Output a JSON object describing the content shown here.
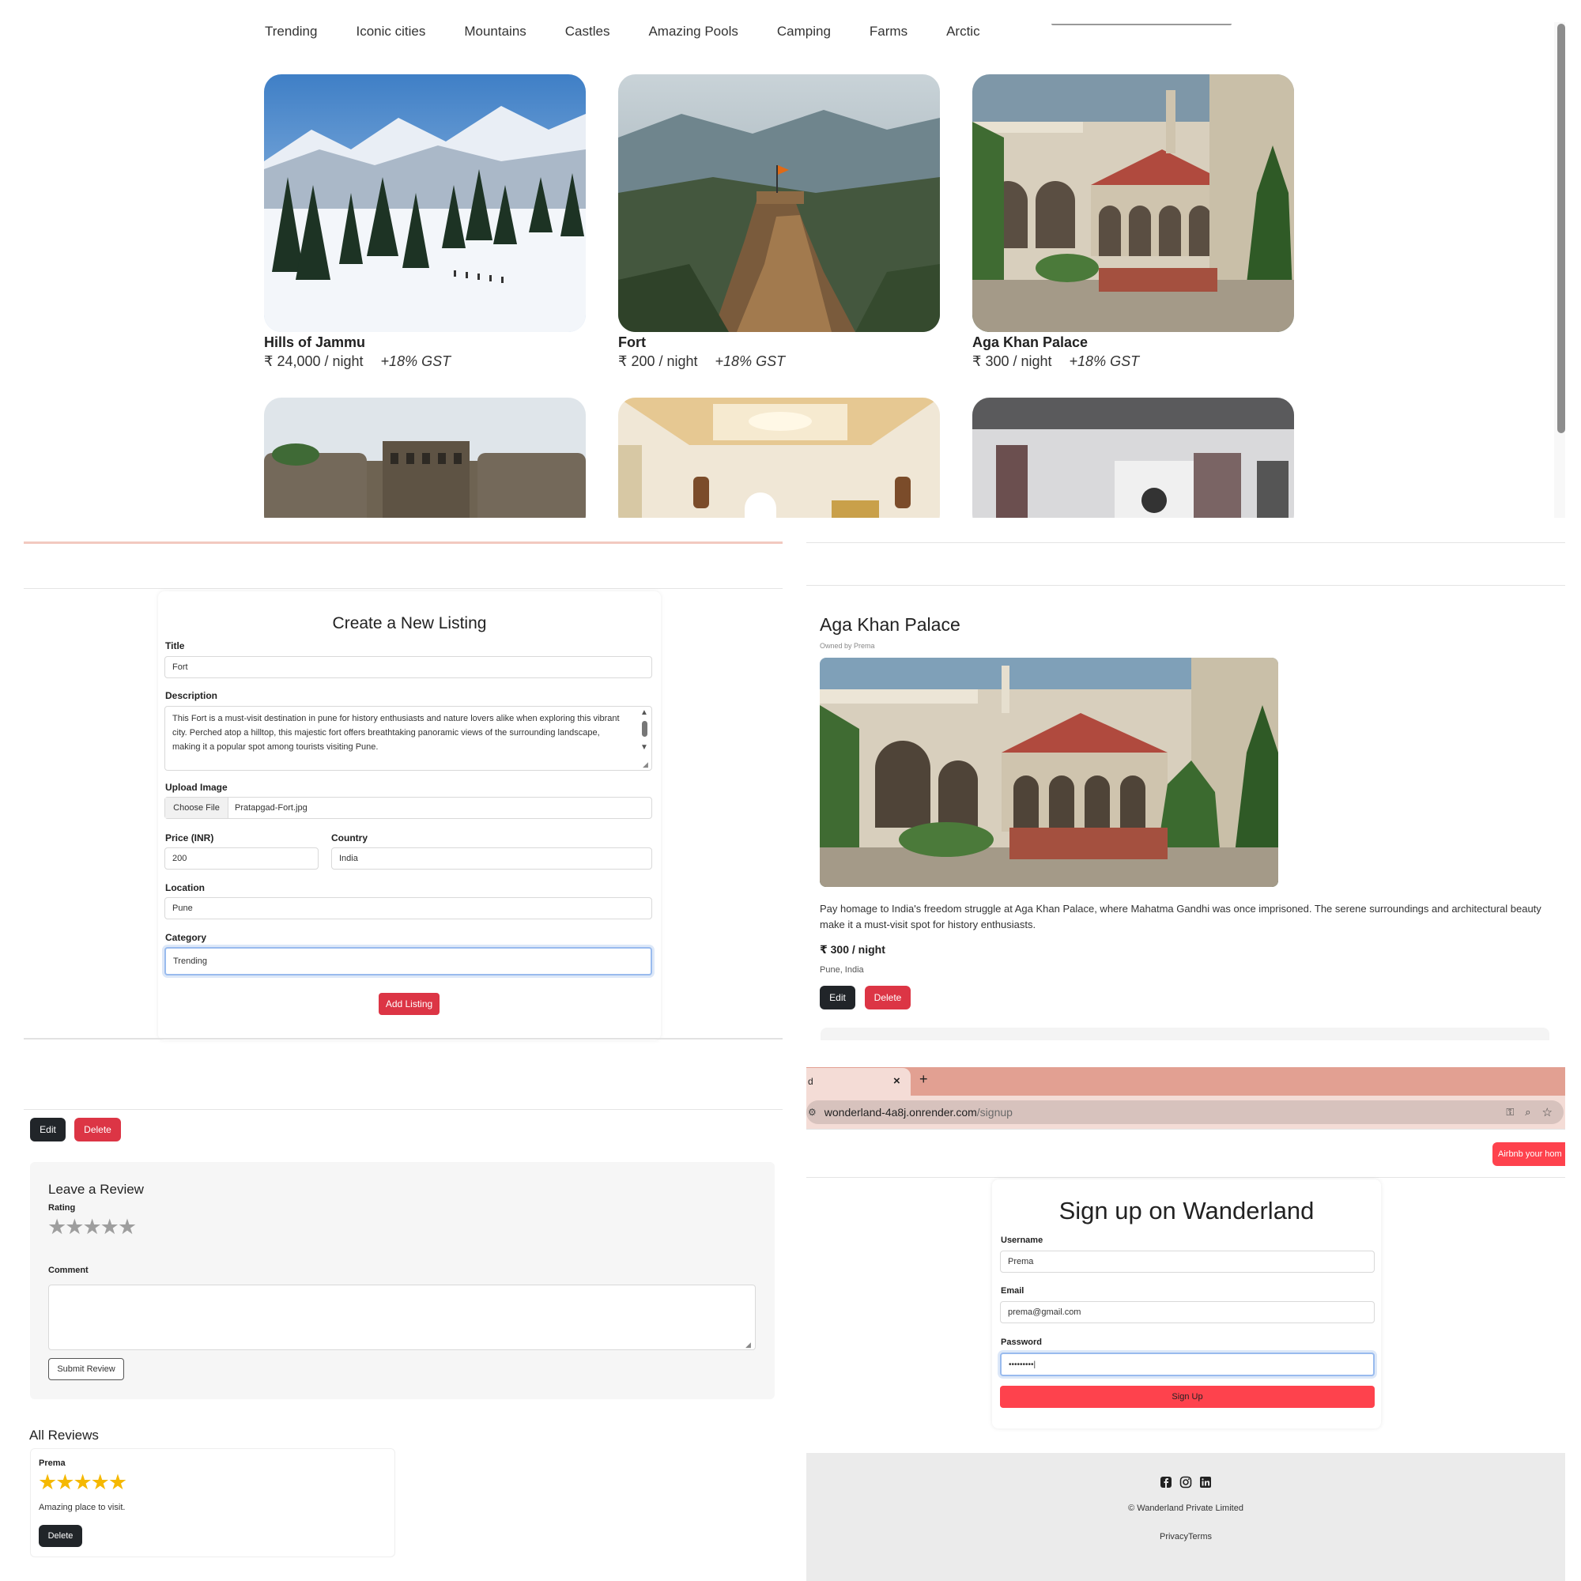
{
  "categories": [
    "Trending",
    "Iconic cities",
    "Mountains",
    "Castles",
    "Amazing Pools",
    "Camping",
    "Farms",
    "Arctic"
  ],
  "listings": [
    {
      "title": "Hills of Jammu",
      "price": "₹ 24,000 / night",
      "gst": "+18% GST",
      "image": "snowy-mountains"
    },
    {
      "title": "Fort",
      "price": "₹ 200 / night",
      "gst": "+18% GST",
      "image": "hill-fort"
    },
    {
      "title": "Aga Khan Palace",
      "price": "₹ 300 / night",
      "gst": "+18% GST",
      "image": "palace"
    }
  ],
  "create_form": {
    "heading": "Create a New Listing",
    "title_label": "Title",
    "title_value": "Fort",
    "description_label": "Description",
    "description_value": "This Fort is a must-visit destination in pune for history enthusiasts and nature lovers alike when exploring this vibrant city. Perched atop a hilltop, this majestic fort offers breathtaking panoramic views of the surrounding landscape, making it a popular spot among tourists visiting Pune.",
    "image_label": "Upload Image",
    "choose_file_label": "Choose File",
    "file_name": "Pratapgad-Fort.jpg",
    "price_label": "Price (INR)",
    "price_value": "200",
    "country_label": "Country",
    "country_value": "India",
    "location_label": "Location",
    "location_value": "Pune",
    "category_label": "Category",
    "category_value": "Trending",
    "submit_label": "Add Listing"
  },
  "show_page": {
    "title": "Aga Khan Palace",
    "owner": "Owned by Prema",
    "description": "Pay homage to India's freedom struggle at Aga Khan Palace, where Mahatma Gandhi was once imprisoned. The serene surroundings and architectural beauty make it a must-visit spot for history enthusiasts.",
    "price": "₹ 300 / night",
    "location": "Pune, India",
    "edit_label": "Edit",
    "delete_label": "Delete"
  },
  "review_page": {
    "edit_label": "Edit",
    "delete_label": "Delete",
    "heading": "Leave a Review",
    "rating_label": "Rating",
    "rating_value": 0,
    "comment_label": "Comment",
    "submit_label": "Submit Review",
    "all_reviews_heading": "All Reviews",
    "reviews": [
      {
        "author": "Prema",
        "rating": 5,
        "text": "Amazing place to visit.",
        "delete_label": "Delete"
      }
    ]
  },
  "browser": {
    "tab_title": "d",
    "tab_close": "×",
    "new_tab": "+",
    "url_host": "wonderland-4a8j.onrender.com",
    "url_path": "/signup",
    "nav_button": "Airbnb your hom"
  },
  "signup": {
    "heading": "Sign up on Wanderland",
    "username_label": "Username",
    "username_value": "Prema",
    "email_label": "Email",
    "email_value": "prema@gmail.com",
    "password_label": "Password",
    "password_value": "•••••••••|",
    "submit_label": "Sign Up"
  },
  "footer": {
    "copyright": "© Wanderland Private Limited",
    "links": "PrivacyTerms",
    "social_icons": [
      "facebook-icon",
      "instagram-icon",
      "linkedin-icon"
    ]
  },
  "colors": {
    "brand": "#fe424d",
    "danger": "#dc3545",
    "dark": "#212529",
    "star_filled": "#f5b800",
    "star_empty": "#9e9e9e",
    "footer_bg": "#ebebeb",
    "browser_tabbar": "#e2a092"
  }
}
